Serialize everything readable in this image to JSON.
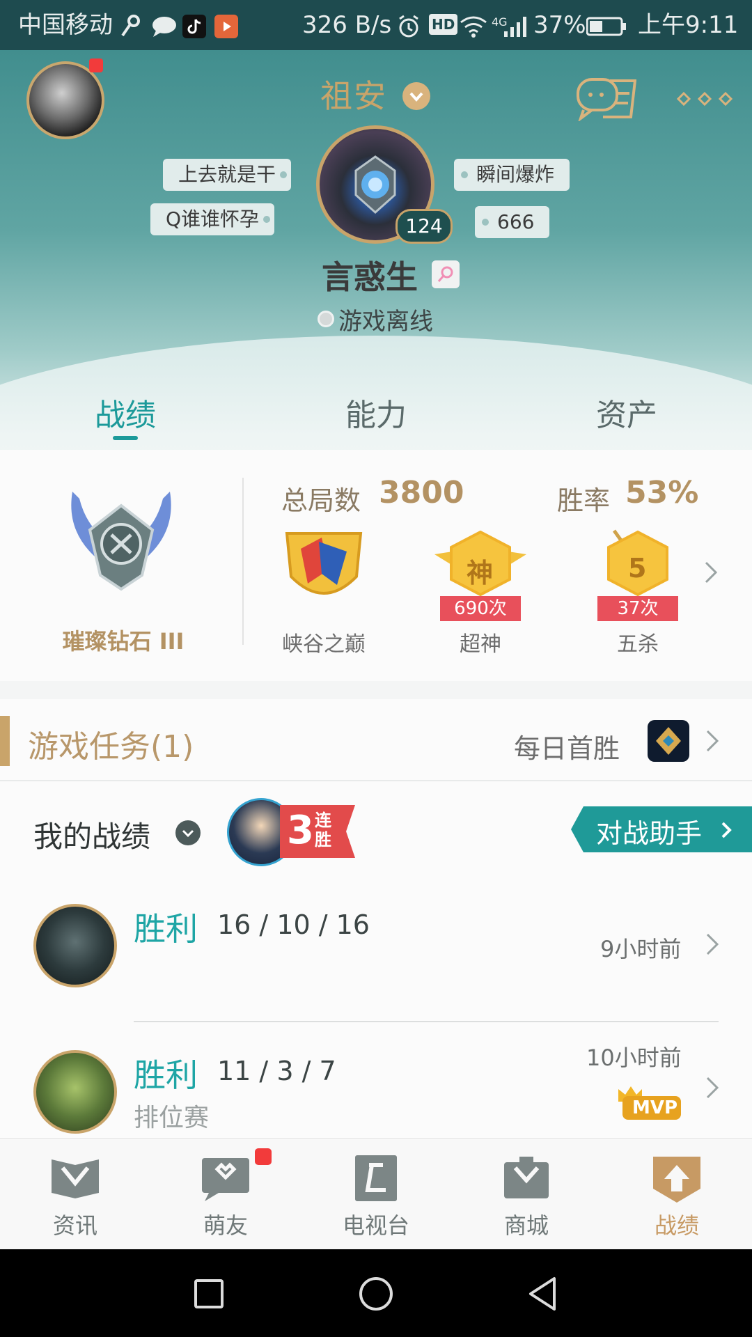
{
  "status_bar": {
    "carrier": "中国移动",
    "speed": "326 B/s",
    "hd": "HD",
    "network": "4G",
    "battery": "37%",
    "time": "上午9:11"
  },
  "header": {
    "region": "祖安",
    "level": "124",
    "username": "言惑生",
    "status": "游戏离线",
    "tags_left": [
      "上去就是干",
      "Q谁谁怀孕"
    ],
    "tags_right": [
      "瞬间爆炸",
      "666"
    ]
  },
  "tabs": [
    {
      "label": "战绩"
    },
    {
      "label": "能力"
    },
    {
      "label": "资产"
    }
  ],
  "rank_card": {
    "rank": "璀璨钻石 III",
    "total_games_label": "总局数",
    "total_games": "3800",
    "win_rate_label": "胜率",
    "win_rate": "53%",
    "badges": [
      {
        "label": "峡谷之巅",
        "count": ""
      },
      {
        "label": "超神",
        "count": "690次",
        "glyph": "神"
      },
      {
        "label": "五杀",
        "count": "37次",
        "glyph": "5"
      }
    ]
  },
  "tasks": {
    "title": "游戏任务(1)",
    "daily": "每日首胜"
  },
  "my_record": {
    "title": "我的战绩",
    "streak_num": "3",
    "streak_text": "连胜",
    "assistant": "对战助手"
  },
  "matches": [
    {
      "result": "胜利",
      "kda": "16 / 10 / 16",
      "time": "9小时前",
      "mode": "",
      "mvp": false
    },
    {
      "result": "胜利",
      "kda": "11 / 3 / 7",
      "time": "10小时前",
      "mode": "排位赛",
      "mvp": true,
      "mvp_label": "MVP"
    }
  ],
  "bottom_nav": [
    {
      "label": "资讯"
    },
    {
      "label": "萌友"
    },
    {
      "label": "电视台"
    },
    {
      "label": "商城"
    },
    {
      "label": "战绩"
    }
  ],
  "colors": {
    "accent": "#1c9a9a",
    "gold": "#b39263",
    "header_top": "#418e8e"
  }
}
